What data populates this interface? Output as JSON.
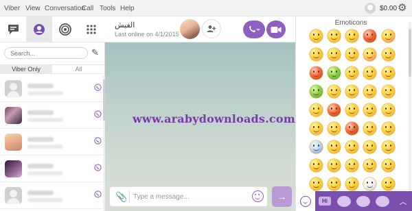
{
  "menubar": {
    "items": [
      "Viber",
      "View",
      "Conversation",
      "Call",
      "Tools",
      "Help"
    ],
    "balance": "$0.00"
  },
  "left_panel": {
    "search_placeholder": "Search...",
    "filters": [
      "Viber Only",
      "All"
    ],
    "contacts_count_visible": 6
  },
  "chat": {
    "contact_name": "الفيش",
    "status": "Last online on 4/1/2015",
    "watermark": "www.arabydownloads.com",
    "input_placeholder": "Type a message..."
  },
  "emoticons": {
    "title": "Emoticons"
  },
  "colors": {
    "accent": "#8d5fc0",
    "sticker_bar": "#7a4fae"
  }
}
